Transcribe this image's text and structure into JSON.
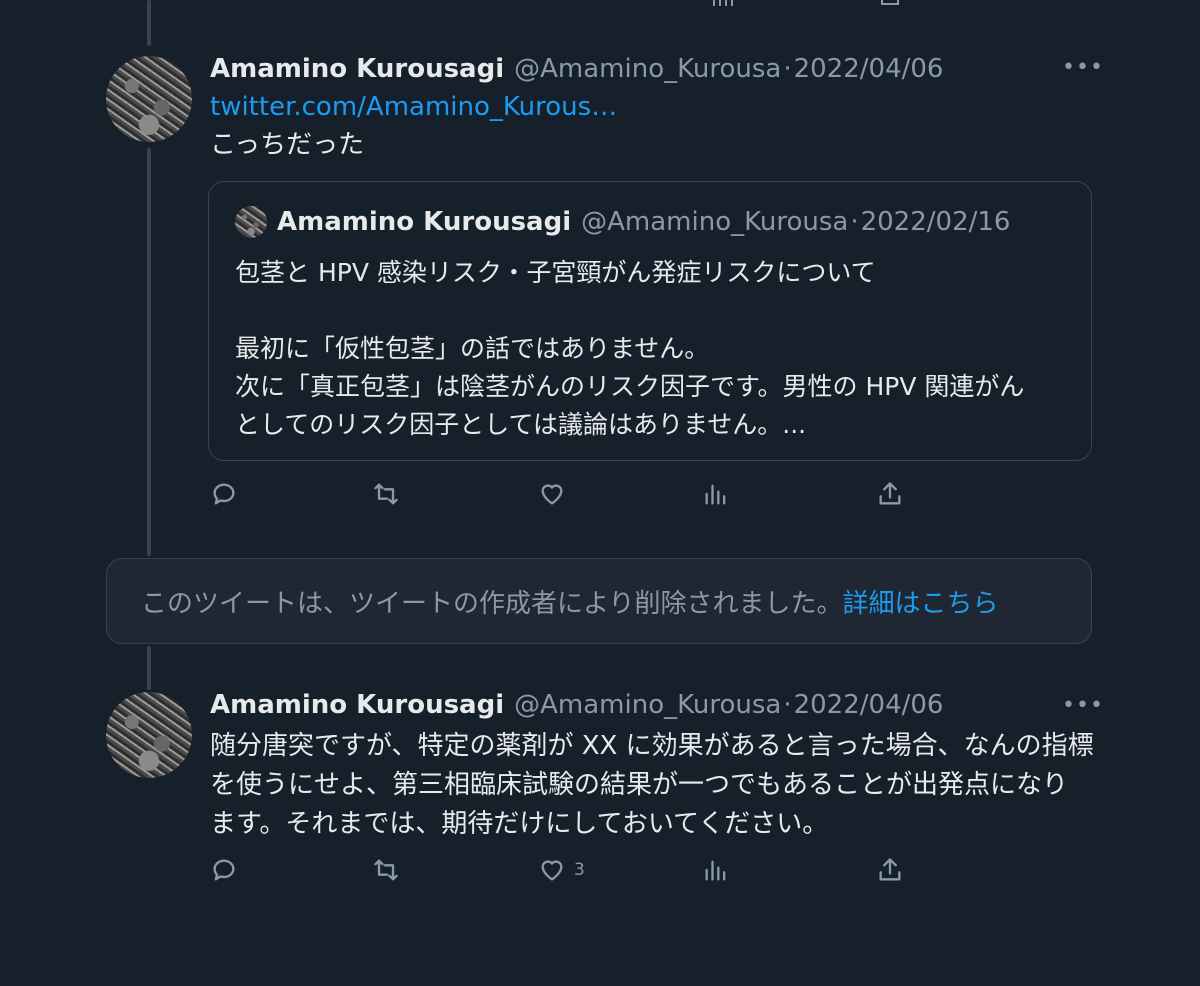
{
  "tweets": [
    {
      "name": "Amamino Kurousagi",
      "handle": "@Amamino_Kurousa",
      "separator": "·",
      "date": "2022/04/06",
      "link": "twitter.com/Amamino_Kurous…",
      "text": "こっちだった",
      "quote": {
        "name": "Amamino Kurousagi",
        "handle": "@Amamino_Kurousa",
        "separator": "·",
        "date": "2022/02/16",
        "lines": [
          "包茎と HPV 感染リスク・子宮頸がん発症リスクについて",
          "",
          "最初に「仮性包茎」の話ではありません。",
          "次に「真正包茎」は陰茎がんのリスク因子です。男性の HPV 関連がん",
          "としてのリスク因子としては議論はありません。..."
        ]
      }
    },
    {
      "name": "Amamino Kurousagi",
      "handle": "@Amamino_Kurousa",
      "separator": "·",
      "date": "2022/04/06",
      "lines": [
        "随分唐突ですが、特定の薬剤が XX に効果があると言った場合、なんの指標",
        "を使うにせよ、第三相臨床試験の結果が一つでもあることが出発点になり",
        "ます。それまでは、期待だけにしておいてください。"
      ],
      "like_count": "3"
    }
  ],
  "deleted_notice": {
    "text": "このツイートは、ツイートの作成者により削除されました。",
    "link": "詳細はこちら"
  },
  "more_icon": "•••",
  "icons": [
    "reply-icon",
    "retweet-icon",
    "like-icon",
    "analytics-icon",
    "share-icon"
  ]
}
